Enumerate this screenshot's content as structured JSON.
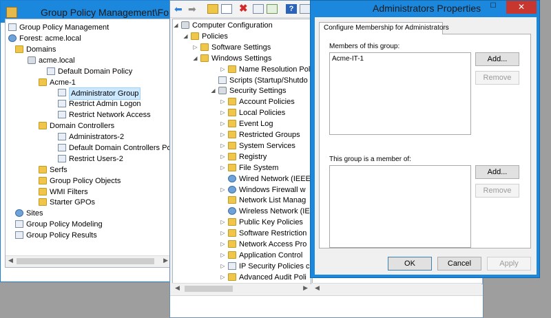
{
  "left_window": {
    "title": "Group Policy Management\\Fore",
    "tree": [
      {
        "label": "Group Policy Management",
        "icon": "gpm-icon"
      },
      {
        "label": "Forest: acme.local",
        "icon": "forest-icon"
      },
      {
        "label": "Domains",
        "icon": "folder-icon"
      },
      {
        "label": "acme.local",
        "icon": "domain-icon"
      },
      {
        "label": "Default Domain Policy",
        "icon": "gpo-link-icon"
      },
      {
        "label": "Acme-1",
        "icon": "ou-icon"
      },
      {
        "label": "Administrator Group",
        "icon": "gpo-link-icon"
      },
      {
        "label": "Restrict Admin Logon",
        "icon": "gpo-link-icon"
      },
      {
        "label": "Restrict Network Access",
        "icon": "gpo-link-icon"
      },
      {
        "label": "Domain Controllers",
        "icon": "ou-icon"
      },
      {
        "label": "Administrators-2",
        "icon": "gpo-link-icon"
      },
      {
        "label": "Default Domain Controllers Po",
        "icon": "gpo-link-icon"
      },
      {
        "label": "Restrict Users-2",
        "icon": "gpo-link-icon"
      },
      {
        "label": "Serfs",
        "icon": "ou-icon"
      },
      {
        "label": "Group Policy Objects",
        "icon": "folder-icon"
      },
      {
        "label": "WMI Filters",
        "icon": "folder-icon"
      },
      {
        "label": "Starter GPOs",
        "icon": "folder-icon"
      },
      {
        "label": "Sites",
        "icon": "sites-icon"
      },
      {
        "label": "Group Policy Modeling",
        "icon": "modeling-icon"
      },
      {
        "label": "Group Policy Results",
        "icon": "results-icon"
      }
    ]
  },
  "middle_window": {
    "tree": [
      {
        "label": "Computer Configuration",
        "icon": "computer-icon"
      },
      {
        "label": "Policies",
        "icon": "folder-icon"
      },
      {
        "label": "Software Settings",
        "icon": "folder-icon"
      },
      {
        "label": "Windows Settings",
        "icon": "folder-icon"
      },
      {
        "label": "Name Resolution Policy",
        "icon": "folder-icon"
      },
      {
        "label": "Scripts (Startup/Shutdo",
        "icon": "scripts-icon"
      },
      {
        "label": "Security Settings",
        "icon": "security-icon"
      },
      {
        "label": "Account Policies",
        "icon": "folder-icon"
      },
      {
        "label": "Local Policies",
        "icon": "folder-icon"
      },
      {
        "label": "Event Log",
        "icon": "folder-icon"
      },
      {
        "label": "Restricted Groups",
        "icon": "folder-icon"
      },
      {
        "label": "System Services",
        "icon": "folder-icon"
      },
      {
        "label": "Registry",
        "icon": "folder-icon"
      },
      {
        "label": "File System",
        "icon": "folder-icon"
      },
      {
        "label": "Wired Network (IEEE",
        "icon": "network-icon"
      },
      {
        "label": "Windows Firewall w",
        "icon": "firewall-icon"
      },
      {
        "label": "Network List Manag",
        "icon": "folder-icon"
      },
      {
        "label": "Wireless Network (IE",
        "icon": "network-icon"
      },
      {
        "label": "Public Key Policies",
        "icon": "folder-icon"
      },
      {
        "label": "Software Restriction",
        "icon": "folder-icon"
      },
      {
        "label": "Network Access Pro",
        "icon": "folder-icon"
      },
      {
        "label": "Application Control",
        "icon": "folder-icon"
      },
      {
        "label": "IP Security Policies c",
        "icon": "ipsec-icon"
      },
      {
        "label": "Advanced Audit Poli",
        "icon": "folder-icon"
      }
    ]
  },
  "dialog": {
    "title": "Administrators Properties",
    "close_glyph": "✕",
    "tab_label": "Configure Membership for Administrators",
    "members_label": "Members of this group:",
    "members": [
      "Acme-IT-1"
    ],
    "member_of_label": "This group is a member of:",
    "member_of": [],
    "add_label": "Add...",
    "remove_label": "Remove",
    "ok_label": "OK",
    "cancel_label": "Cancel",
    "apply_label": "Apply"
  }
}
